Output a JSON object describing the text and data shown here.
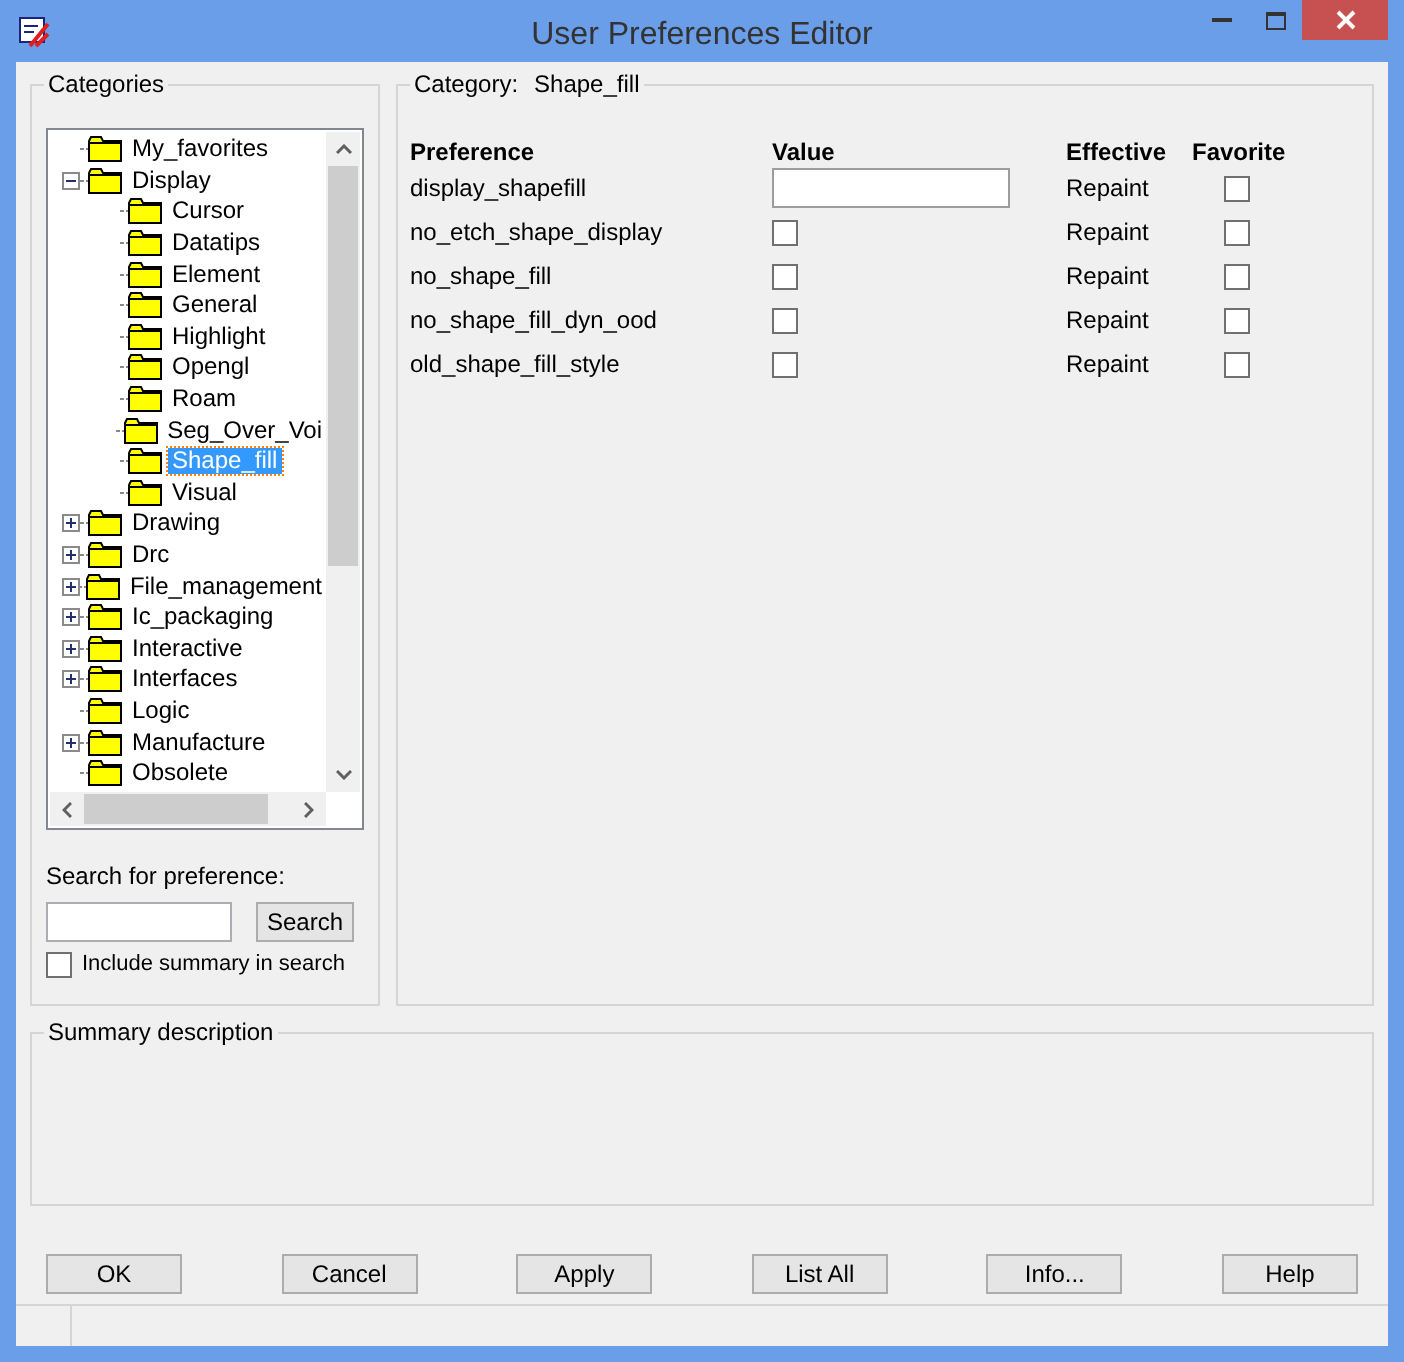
{
  "window": {
    "title": "User Preferences Editor"
  },
  "categories": {
    "title": "Categories",
    "tree": [
      {
        "label": "My_favorites",
        "selected": false
      },
      {
        "label": "Display",
        "selected": false,
        "expanded": true,
        "children": [
          {
            "label": "Cursor",
            "selected": false
          },
          {
            "label": "Datatips",
            "selected": false
          },
          {
            "label": "Element",
            "selected": false
          },
          {
            "label": "General",
            "selected": false
          },
          {
            "label": "Highlight",
            "selected": false
          },
          {
            "label": "Opengl",
            "selected": false
          },
          {
            "label": "Roam",
            "selected": false
          },
          {
            "label": "Seg_Over_Voi",
            "selected": false
          },
          {
            "label": "Shape_fill",
            "selected": true
          },
          {
            "label": "Visual",
            "selected": false
          }
        ]
      },
      {
        "label": "Drawing",
        "selected": false,
        "expanded": false
      },
      {
        "label": "Drc",
        "selected": false,
        "expanded": false
      },
      {
        "label": "File_management",
        "selected": false,
        "expanded": false
      },
      {
        "label": "Ic_packaging",
        "selected": false,
        "expanded": false
      },
      {
        "label": "Interactive",
        "selected": false,
        "expanded": false
      },
      {
        "label": "Interfaces",
        "selected": false,
        "expanded": false
      },
      {
        "label": "Logic",
        "selected": false
      },
      {
        "label": "Manufacture",
        "selected": false,
        "expanded": false
      },
      {
        "label": "Obsolete",
        "selected": false
      }
    ],
    "search_label": "Search for preference:",
    "search_button": "Search",
    "include_summary": {
      "label": "Include summary in search",
      "checked": false
    }
  },
  "category": {
    "label": "Category:",
    "value": "Shape_fill",
    "columns": [
      "Preference",
      "Value",
      "Effective",
      "Favorite"
    ],
    "rows": [
      {
        "name": "display_shapefill",
        "kind": "text",
        "effective": "Repaint",
        "favorite": false
      },
      {
        "name": "no_etch_shape_display",
        "kind": "checkbox",
        "checked": false,
        "effective": "Repaint",
        "favorite": false
      },
      {
        "name": "no_shape_fill",
        "kind": "checkbox",
        "checked": false,
        "effective": "Repaint",
        "favorite": false
      },
      {
        "name": "no_shape_fill_dyn_ood",
        "kind": "checkbox",
        "checked": false,
        "effective": "Repaint",
        "favorite": false
      },
      {
        "name": "old_shape_fill_style",
        "kind": "checkbox",
        "checked": false,
        "effective": "Repaint",
        "favorite": false
      }
    ]
  },
  "summary": {
    "title": "Summary description"
  },
  "buttons": [
    "OK",
    "Cancel",
    "Apply",
    "List All",
    "Info...",
    "Help"
  ]
}
